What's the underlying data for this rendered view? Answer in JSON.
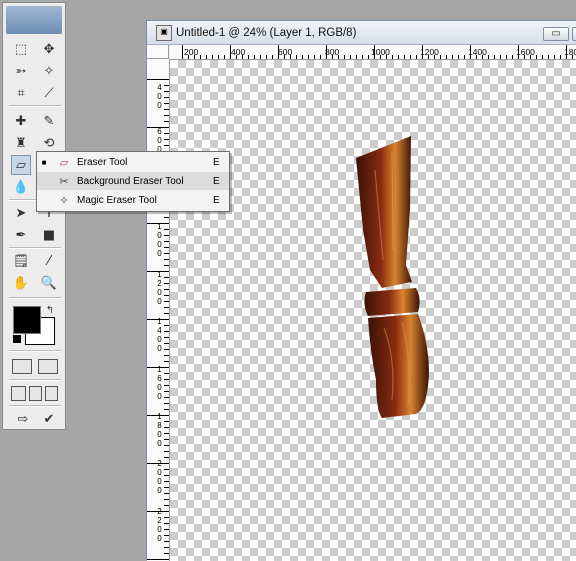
{
  "document": {
    "title": "Untitled-1 @ 24% (Layer 1, RGB/8)",
    "doc_icon": "document-icon",
    "buttons": {
      "minimize": "▭",
      "maximize": "□"
    }
  },
  "ruler": {
    "horizontal": [
      "200",
      "400",
      "600",
      "800",
      "1000",
      "1200",
      "1400",
      "1600",
      "1800"
    ],
    "vertical": [
      "400",
      "600",
      "800",
      "1000",
      "1200",
      "1400",
      "1600",
      "1800",
      "2000",
      "2200"
    ]
  },
  "flyout": {
    "items": [
      {
        "label": "Eraser Tool",
        "shortcut": "E",
        "icon": "eraser-icon",
        "selected": true
      },
      {
        "label": "Background Eraser Tool",
        "shortcut": "E",
        "icon": "background-eraser-icon",
        "selected": false
      },
      {
        "label": "Magic Eraser Tool",
        "shortcut": "E",
        "icon": "magic-eraser-icon",
        "selected": false
      }
    ],
    "bullet": "■"
  },
  "tools": {
    "icons": [
      "marquee-icon",
      "move-icon",
      "lasso-icon",
      "magic-wand-icon",
      "crop-icon",
      "slice-icon",
      "healing-brush-icon",
      "brush-icon",
      "clone-stamp-icon",
      "history-brush-icon",
      "eraser-icon",
      "gradient-icon",
      "blur-icon",
      "dodge-icon",
      "path-selection-icon",
      "type-icon",
      "pen-icon",
      "shape-icon",
      "notes-icon",
      "eyedropper-icon",
      "hand-icon",
      "zoom-icon"
    ]
  },
  "colors": {
    "foreground": "#000000",
    "background": "#ffffff",
    "wood_dark": "#3a1207",
    "wood_mid": "#8a2c10",
    "wood_light": "#d9842e"
  }
}
